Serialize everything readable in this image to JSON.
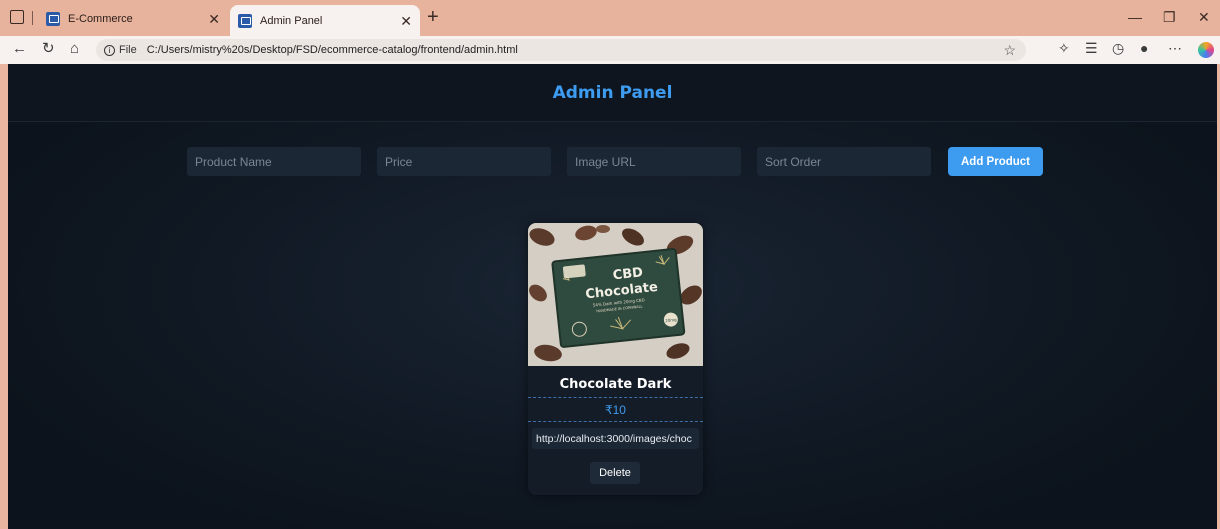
{
  "browser": {
    "tabs": [
      {
        "title": "E-Commerce",
        "active": false
      },
      {
        "title": "Admin Panel",
        "active": true
      }
    ],
    "address": {
      "prefix": "File",
      "url": "C:/Users/mistry%20s/Desktop/FSD/ecommerce-catalog/frontend/admin.html"
    }
  },
  "page": {
    "title": "Admin Panel"
  },
  "form": {
    "name_placeholder": "Product Name",
    "price_placeholder": "Price",
    "image_placeholder": "Image URL",
    "sort_placeholder": "Sort Order",
    "add_label": "Add Product"
  },
  "products": [
    {
      "name": "Chocolate Dark",
      "price": "₹10",
      "image_url": "http://localhost:3000/images/choc",
      "image_text": {
        "line1": "CBD",
        "line2": "Chocolate",
        "line3": "54% Dark with 20mg CBD",
        "line4": "HANDMADE IN CORNWALL",
        "badge": "20mg"
      },
      "delete_label": "Delete"
    }
  ],
  "colors": {
    "accent": "#3d9bf0",
    "page_bg": "#111a25",
    "card_bg": "#141c27",
    "input_bg": "#1c2735",
    "chrome_tabbar": "#e8b39d"
  }
}
